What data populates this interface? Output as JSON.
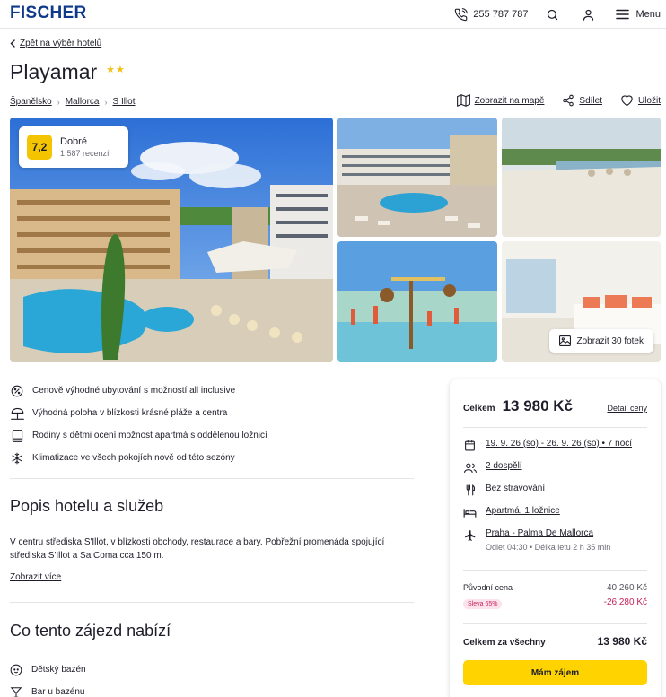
{
  "header": {
    "logo": "FISCHER",
    "phone": "255 787 787",
    "menu_label": "Menu"
  },
  "nav": {
    "back_label": "Zpět na výběr hotelů"
  },
  "hotel": {
    "name": "Playamar",
    "stars": "★★",
    "breadcrumbs": [
      "Španělsko",
      "Mallorca",
      "S Illot"
    ],
    "actions": {
      "map": "Zobrazit na mapě",
      "share": "Sdílet",
      "save": "Uložit"
    }
  },
  "rating": {
    "score": "7,2",
    "word": "Dobré",
    "count": "1 587 recenzí"
  },
  "gallery": {
    "show_photos": "Zobrazit 30 fotek"
  },
  "features": [
    {
      "icon": "percent-icon",
      "text": "Cenově výhodné ubytování s možností all inclusive"
    },
    {
      "icon": "beach-umbrella-icon",
      "text": "Výhodná poloha v blízkosti krásné pláže a centra"
    },
    {
      "icon": "door-icon",
      "text": "Rodiny s dětmi ocení možnost apartmá s oddělenou ložnicí"
    },
    {
      "icon": "snowflake-icon",
      "text": "Klimatizace ve všech pokojích nově od této sezóny"
    }
  ],
  "description": {
    "title": "Popis hotelu a služeb",
    "text": "V centru střediska S'Illot, v blízkosti obchody, restaurace a bary. Pobřežní promenáda spojující střediska S'Illot a Sa Coma cca 150 m.",
    "more": "Zobrazit více"
  },
  "offers": {
    "title": "Co tento zájezd nabízí",
    "items": [
      {
        "icon": "child-face-icon",
        "text": "Dětský bazén"
      },
      {
        "icon": "cocktail-icon",
        "text": "Bar u bazénu"
      }
    ]
  },
  "booking": {
    "total_label": "Celkem",
    "total_value": "13 980 Kč",
    "detail_link": "Detail ceny",
    "dates": "19. 9. 26 (so) - 26. 9. 26 (so) • 7 nocí",
    "persons": "2 dospělí",
    "board": "Bez stravování",
    "room": "Apartmá, 1 ložnice",
    "flight": "Praha - Palma De Mallorca",
    "flight_detail": "Odlet 04:30 • Délka letu 2 h 35 min",
    "original_label": "Původní cena",
    "original_value": "40 260 Kč",
    "discount_badge": "Sleva 65%",
    "discount_value": "-26 280 Kč",
    "all_label": "Celkem za všechny",
    "all_value": "13 980 Kč",
    "cta": "Mám zájem"
  },
  "colors": {
    "brand": "#0f3a8c",
    "accent_yellow": "#ffd300",
    "discount": "#c4245d"
  }
}
